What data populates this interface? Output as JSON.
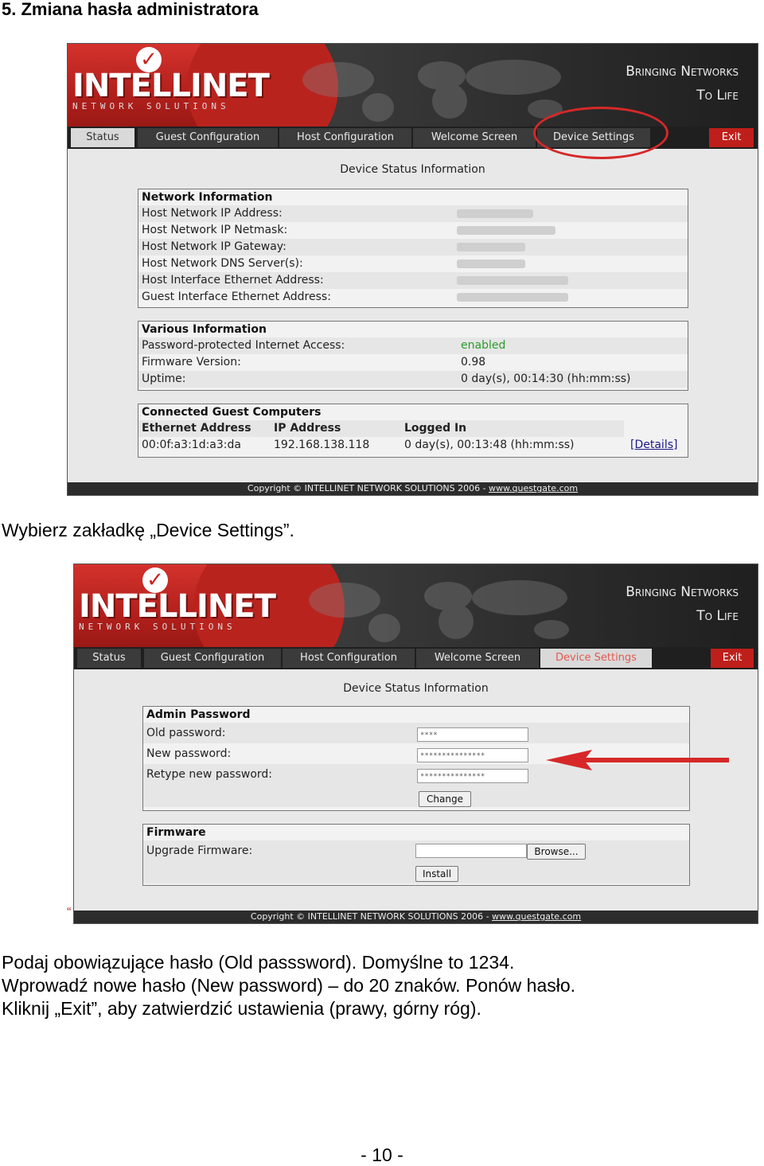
{
  "heading": "5. Zmiana hasła administratora",
  "logo": {
    "name": "INTELLINET",
    "sub": "NETWORK SOLUTIONS",
    "check": "✓"
  },
  "slogan": {
    "line1": "Bringing Networks",
    "line2": "To Life"
  },
  "tabs": {
    "status": "Status",
    "guest": "Guest Configuration",
    "host": "Host Configuration",
    "welcome": "Welcome Screen",
    "device": "Device Settings",
    "exit": "Exit"
  },
  "footer": {
    "text": "Copyright © INTELLINET NETWORK SOLUTIONS 2006 - ",
    "link": "www.questgate.com"
  },
  "screen1": {
    "section_title": "Device Status Information",
    "network": {
      "title": "Network Information",
      "rows": [
        "Host Network IP Address:",
        "Host Network IP Netmask:",
        "Host Network IP Gateway:",
        "Host Network DNS Server(s):",
        "Host Interface Ethernet Address:",
        "Guest Interface Ethernet Address:"
      ]
    },
    "various": {
      "title": "Various Information",
      "rows": [
        {
          "label": "Password-protected Internet Access:",
          "value": "enabled"
        },
        {
          "label": "Firmware Version:",
          "value": "0.98"
        },
        {
          "label": "Uptime:",
          "value": "0 day(s), 00:14:30 (hh:mm:ss)"
        }
      ]
    },
    "guests": {
      "title": "Connected Guest Computers",
      "headers": {
        "eth": "Ethernet Address",
        "ip": "IP Address",
        "logged": "Logged In"
      },
      "row": {
        "eth": "00:0f:a3:1d:a3:da",
        "ip": "192.168.138.118",
        "logged": "0 day(s), 00:13:48 (hh:mm:ss)",
        "details": "[Details]"
      }
    }
  },
  "caption1": "Wybierz zakładkę „Device Settings”.",
  "screen2": {
    "section_title": "Device Status Information",
    "admin": {
      "title": "Admin Password",
      "old_label": "Old password:",
      "new_label": "New password:",
      "retype_label": "Retype new password:",
      "old_value": "****",
      "new_value": "***************",
      "retype_value": "***************",
      "change": "Change"
    },
    "firmware": {
      "title": "Firmware",
      "upgrade_label": "Upgrade Firmware:",
      "browse": "Browse...",
      "install": "Install"
    }
  },
  "stray_mark": "“",
  "instructions": [
    "Podaj obowiązujące hasło (Old passsword). Domyślne to 1234.",
    "Wprowadź nowe hasło (New password) – do 20 znaków. Ponów hasło.",
    "Kliknij „Exit”, aby zatwierdzić ustawienia (prawy, górny róg)."
  ],
  "page_number": "- 10 -",
  "colors": {
    "brand_red": "#c8221c",
    "annotation_red": "#d62828"
  }
}
